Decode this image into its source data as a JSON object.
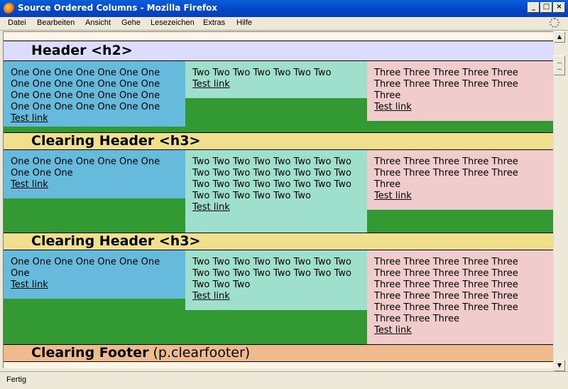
{
  "window": {
    "title": "Source Ordered Columns - Mozilla Firefox"
  },
  "menu": [
    "Datei",
    "Bearbeiten",
    "Ansicht",
    "Gehe",
    "Lesezeichen",
    "Extras",
    "Hilfe"
  ],
  "page": {
    "header": "Header <h2>",
    "sections": [
      {
        "col1": "One One One One One One One One One One One One One One One One One One One One One One One One One One One One",
        "col2": "Two Two Two Two Two Two Two",
        "col3": "Three Three Three Three Three Three Three Three Three Three Three",
        "link": "Test link"
      },
      {
        "heading": "Clearing Header <h3>",
        "col1": "One One One One One One One One One One",
        "col2": "Two Two Two Two Two Two Two Two Two Two Two Two Two Two Two Two Two Two Two Two Two Two Two Two Two Two Two Two Two Two",
        "col3": "Three Three Three Three Three Three Three Three Three Three Three",
        "link": "Test link"
      },
      {
        "heading": "Clearing Header <h3>",
        "col1": "One One One One One One One One",
        "col2": "Two Two Two Two Two Two Two Two Two Two Two Two Two Two Two Two Two Two Two",
        "col3": "Three Three Three Three Three Three Three Three Three Three Three Three Three Three Three Three Three Three Three Three Three Three Three Three Three Three Three Three",
        "link": "Test link"
      }
    ],
    "footer_bold": "Clearing Footer",
    "footer_rest": " (p.clearfooter)"
  },
  "status": "Fertig"
}
